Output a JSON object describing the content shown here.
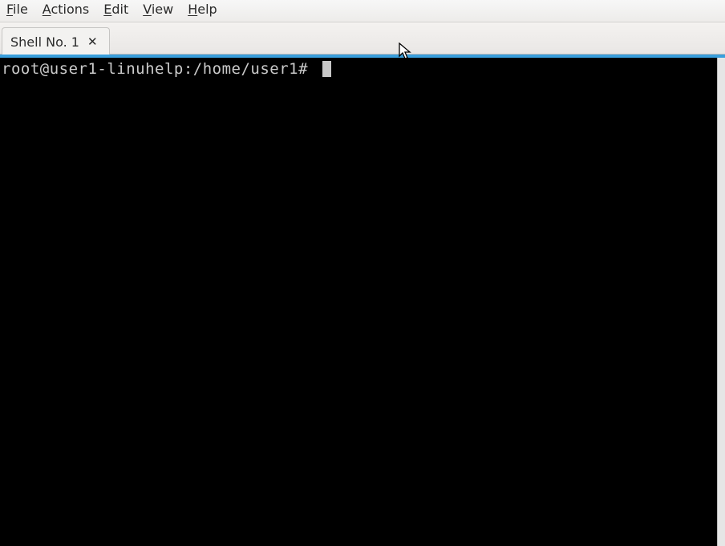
{
  "menubar": {
    "file": "File",
    "actions": "Actions",
    "edit": "Edit",
    "view": "View",
    "help": "Help"
  },
  "tabs": [
    {
      "label": "Shell No. 1",
      "close_glyph": "✕"
    }
  ],
  "terminal": {
    "prompt": "root@user1-linuhelp:/home/user1# "
  }
}
